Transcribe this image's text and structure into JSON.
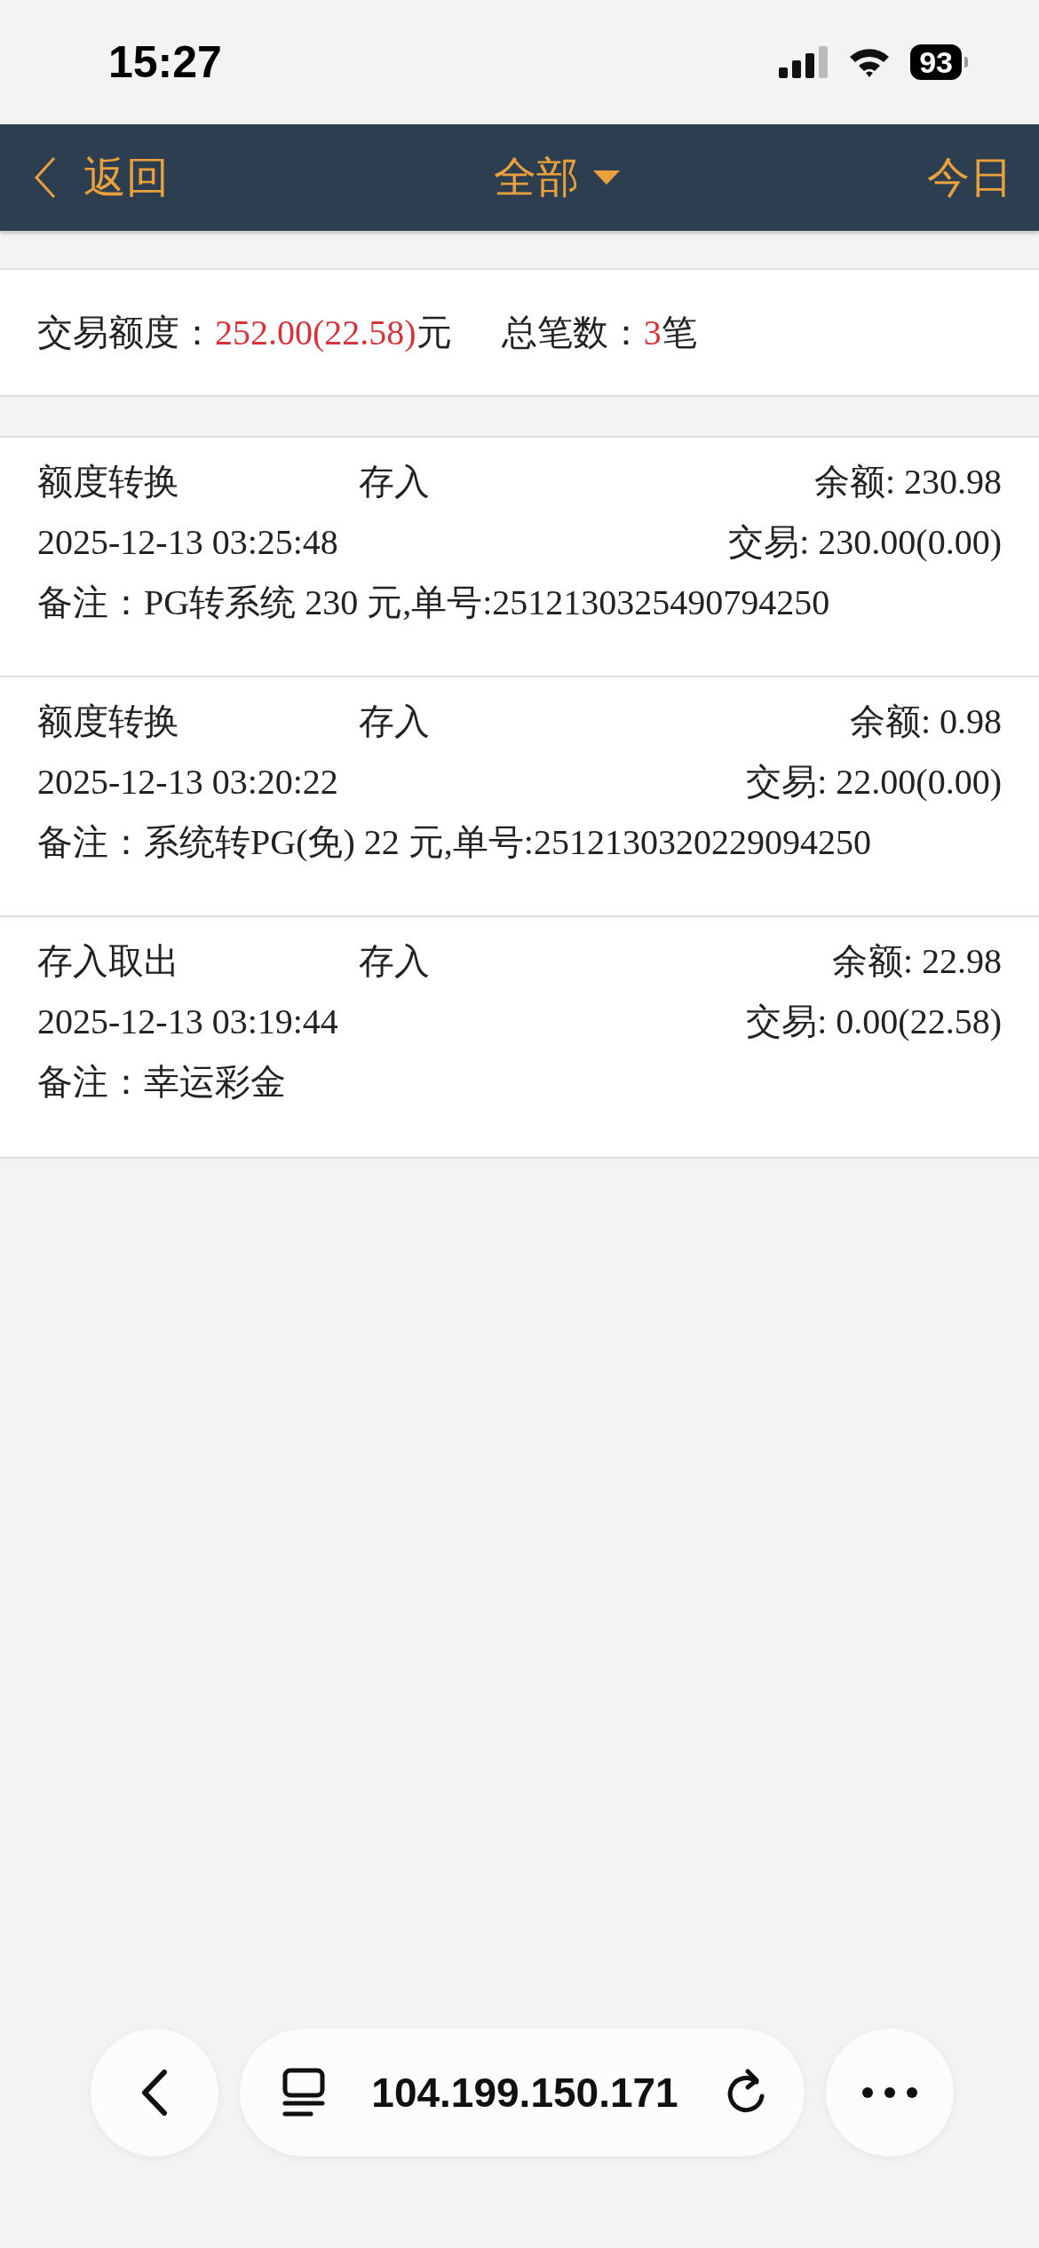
{
  "status_bar": {
    "time": "15:27",
    "battery": "93"
  },
  "nav_bar": {
    "back": "返回",
    "title": "全部",
    "right": "今日"
  },
  "summary": {
    "amount_label": "交易额度：",
    "amount_value": "252.00(22.58)",
    "amount_unit": "元",
    "count_label": "总笔数：",
    "count_value": "3",
    "count_unit": "笔"
  },
  "records": [
    {
      "category": "额度转换",
      "type": "存入",
      "balance": "余额: 230.98",
      "time": "2025-12-13 03:25:48",
      "trade": "交易: 230.00(0.00)",
      "note": "备注：PG转系统 230 元,单号:2512130325490794250"
    },
    {
      "category": "额度转换",
      "type": "存入",
      "balance": "余额: 0.98",
      "time": "2025-12-13 03:20:22",
      "trade": "交易: 22.00(0.00)",
      "note": "备注：系统转PG(免) 22 元,单号:2512130320229094250"
    },
    {
      "category": "存入取出",
      "type": "存入",
      "balance": "余额: 22.98",
      "time": "2025-12-13 03:19:44",
      "trade": "交易: 0.00(22.58)",
      "note": "备注：幸运彩金"
    }
  ],
  "browser_bar": {
    "url": "104.199.150.171"
  }
}
